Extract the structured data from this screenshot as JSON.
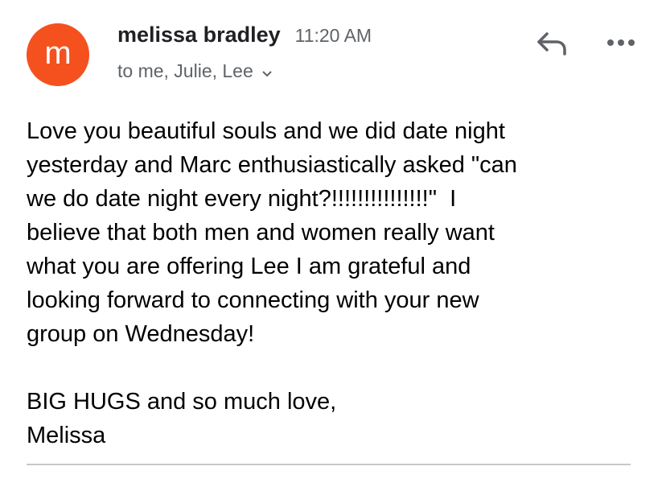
{
  "sender": {
    "avatar_letter": "m",
    "avatar_color": "#f4511e",
    "name": "melissa bradley",
    "time": "11:20 AM",
    "recipients": "to me, Julie, Lee"
  },
  "actions": {
    "reply_icon": "reply-icon",
    "more_icon": "more-horizontal-icon"
  },
  "message": {
    "body": "Love you beautiful souls and we did date night\nyesterday and Marc enthusiastically asked \"can\nwe do date night every night?!!!!!!!!!!!!!!!\"  I\nbelieve that both men and women really want\nwhat you are offering Lee I am grateful and\nlooking forward to connecting with your new\ngroup on Wednesday!\n\nBIG HUGS and so much love,\nMelissa"
  }
}
